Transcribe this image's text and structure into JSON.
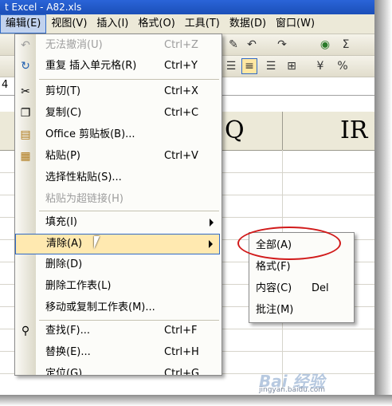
{
  "window": {
    "title": "t Excel - A82.xls"
  },
  "menubar": [
    {
      "label": "编辑(E)",
      "active": true
    },
    {
      "label": "视图(V)"
    },
    {
      "label": "插入(I)"
    },
    {
      "label": "格式(O)"
    },
    {
      "label": "工具(T)"
    },
    {
      "label": "数据(D)"
    },
    {
      "label": "窗口(W)"
    }
  ],
  "sheet": {
    "cell_ref_fragment": "4",
    "col_text_q": "Q",
    "col_text_ir": "IR"
  },
  "edit_menu": {
    "items": [
      {
        "label": "无法撤消(U)",
        "shortcut": "Ctrl+Z",
        "icon": "undo-icon",
        "disabled": true
      },
      {
        "label": "重复 插入单元格(R)",
        "shortcut": "Ctrl+Y",
        "icon": "redo-icon"
      },
      {
        "label": "剪切(T)",
        "shortcut": "Ctrl+X",
        "icon": "cut-icon"
      },
      {
        "label": "复制(C)",
        "shortcut": "Ctrl+C",
        "icon": "copy-icon"
      },
      {
        "label": "Office 剪贴板(B)...",
        "shortcut": "",
        "icon": "clipboard-icon"
      },
      {
        "label": "粘贴(P)",
        "shortcut": "Ctrl+V",
        "icon": "paste-icon"
      },
      {
        "label": "选择性粘贴(S)...",
        "shortcut": ""
      },
      {
        "label": "粘贴为超链接(H)",
        "shortcut": "",
        "disabled": true
      },
      {
        "label": "填充(I)",
        "submenu": true
      },
      {
        "label": "清除(A)",
        "submenu": true,
        "highlighted": true
      },
      {
        "label": "删除(D)"
      },
      {
        "label": "删除工作表(L)"
      },
      {
        "label": "移动或复制工作表(M)..."
      },
      {
        "label": "查找(F)...",
        "shortcut": "Ctrl+F",
        "icon": "find-icon"
      },
      {
        "label": "替换(E)...",
        "shortcut": "Ctrl+H"
      },
      {
        "label": "定位(G)...",
        "shortcut": "Ctrl+G"
      }
    ]
  },
  "clear_submenu": {
    "items": [
      {
        "label": "全部(A)"
      },
      {
        "label": "格式(F)"
      },
      {
        "label": "内容(C)",
        "shortcut": "Del"
      },
      {
        "label": "批注(M)"
      }
    ]
  },
  "watermark": {
    "text": "Bai 经验",
    "sub": "jingyan.baidu.com"
  }
}
